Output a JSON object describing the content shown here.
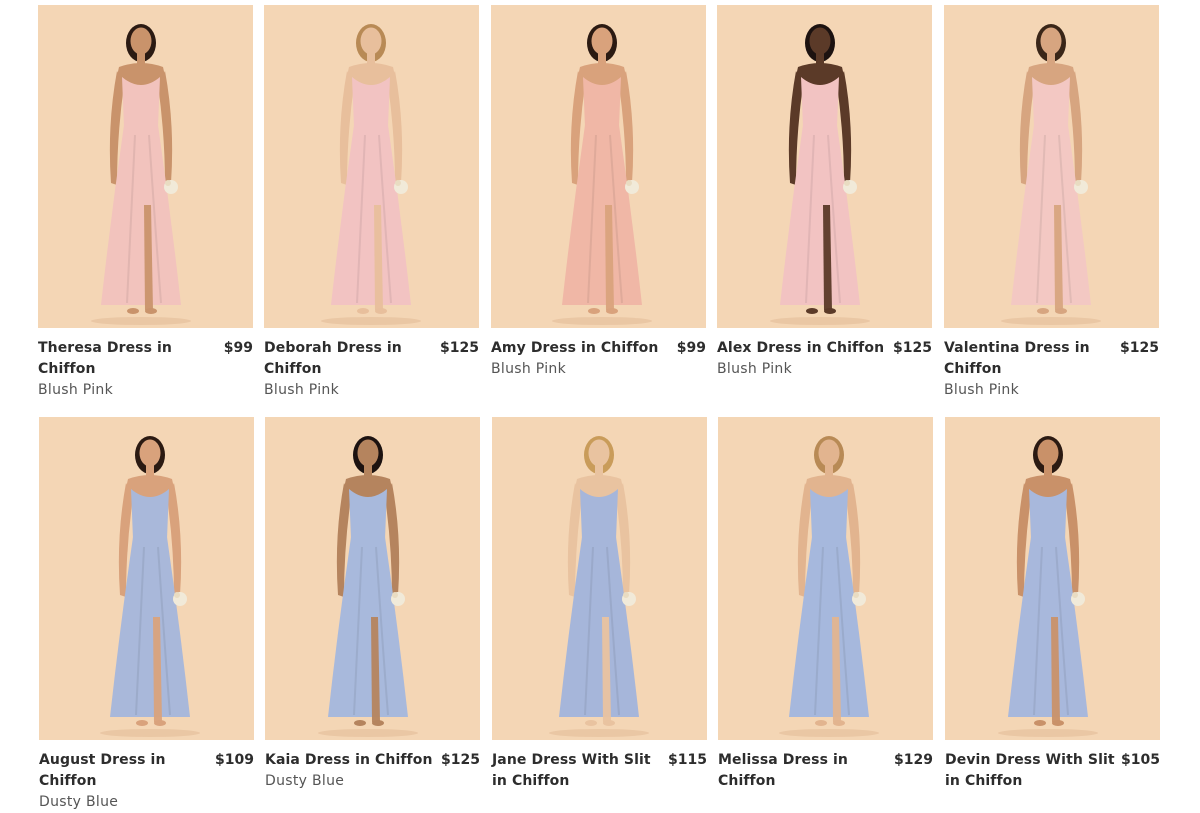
{
  "palette": {
    "background": "#f4d6b5",
    "blush_pink": "#f2c3bd",
    "dusty_blue": "#a9b8da",
    "skin": "#8a5a3c",
    "hair": "#2b1a12",
    "blonde": "#c99c5a",
    "bouquet": "#f1ead9"
  },
  "products": [
    {
      "name": "Theresa Dress in Chiffon",
      "price": "$99",
      "color": "Blush Pink",
      "dress_color": "#f2c3bd",
      "hair": "#2b1a12",
      "bouquet": true
    },
    {
      "name": "Deborah Dress in Chiffon",
      "price": "$125",
      "color": "Blush Pink",
      "dress_color": "#f2c3c2",
      "hair": "#b88a55",
      "bouquet": true
    },
    {
      "name": "Amy Dress in Chiffon",
      "price": "$99",
      "color": "Blush Pink",
      "dress_color": "#f0b7a6",
      "hair": "#2b1a12",
      "bouquet": true
    },
    {
      "name": "Alex Dress in Chiffon",
      "price": "$125",
      "color": "Blush Pink",
      "dress_color": "#f2c3c2",
      "hair": "#1c1210",
      "bouquet": true
    },
    {
      "name": "Valentina Dress in Chiffon",
      "price": "$125",
      "color": "Blush Pink",
      "dress_color": "#f3c8c3",
      "hair": "#3a2618",
      "bouquet": true
    },
    {
      "name": "August Dress in Chiffon",
      "price": "$109",
      "color": "Dusty Blue",
      "dress_color": "#a9b8da",
      "hair": "#2b1a12",
      "bouquet": true
    },
    {
      "name": "Kaia Dress in Chiffon",
      "price": "$125",
      "color": "Dusty Blue",
      "dress_color": "#a8b9dc",
      "hair": "#1c1210",
      "bouquet": true
    },
    {
      "name": "Jane Dress With Slit in Chiffon",
      "price": "$115",
      "color": "",
      "dress_color": "#a6b6da",
      "hair": "#c99c5a",
      "bouquet": true
    },
    {
      "name": "Melissa Dress in Chiffon",
      "price": "$129",
      "color": "",
      "dress_color": "#a6b8dd",
      "hair": "#b88a55",
      "bouquet": true
    },
    {
      "name": "Devin Dress With Slit in Chiffon",
      "price": "$105",
      "color": "",
      "dress_color": "#a8b8dc",
      "hair": "#2b1a12",
      "bouquet": true
    }
  ]
}
